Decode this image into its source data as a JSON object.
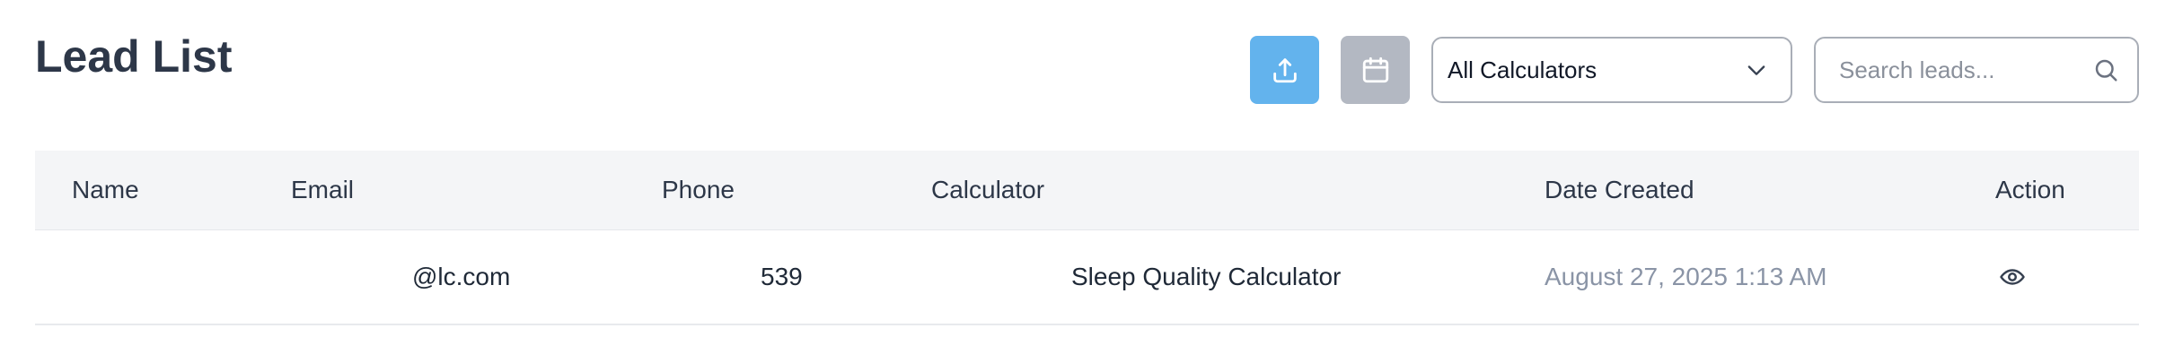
{
  "header": {
    "title": "Lead List"
  },
  "toolbar": {
    "export_icon": "upload-icon",
    "calendar_icon": "calendar-icon",
    "calculator_filter": {
      "selected": "All Calculators",
      "icon": "chevron-down-icon"
    },
    "search": {
      "placeholder": "Search leads...",
      "value": "",
      "icon": "search-icon"
    }
  },
  "table": {
    "columns": [
      "Name",
      "Email",
      "Phone",
      "Calculator",
      "Date Created",
      "Action"
    ],
    "rows": [
      {
        "name": "",
        "email": "@lc.com",
        "phone": "539",
        "calculator": "Sleep Quality Calculator",
        "date_created": "August 27, 2025 1:13 AM",
        "action_icon": "eye-icon"
      }
    ]
  },
  "colors": {
    "export_button": "#63b3ed",
    "calendar_button": "#b3b8c2",
    "title": "#2d3748",
    "header_bg": "#f4f5f7",
    "date_text": "#8a94a6"
  }
}
